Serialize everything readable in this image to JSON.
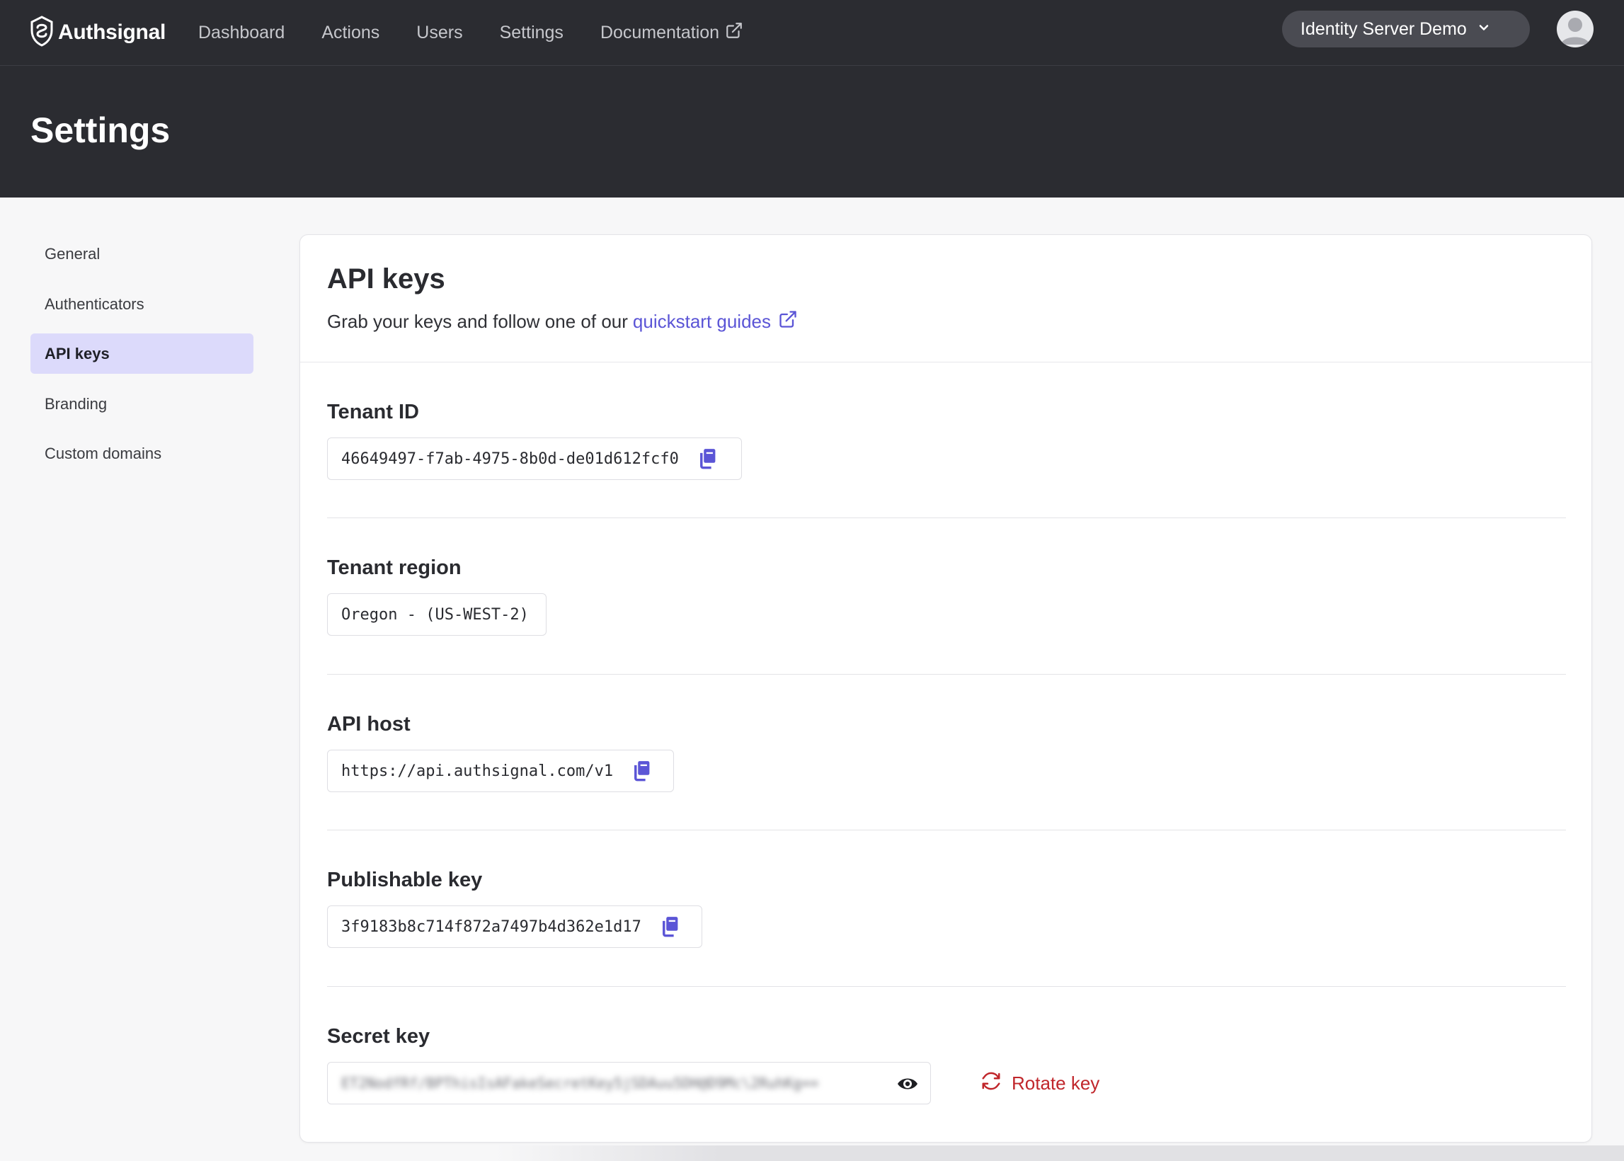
{
  "app": {
    "name": "Authsignal"
  },
  "nav": {
    "items": [
      {
        "label": "Dashboard"
      },
      {
        "label": "Actions"
      },
      {
        "label": "Users"
      },
      {
        "label": "Settings"
      },
      {
        "label": "Documentation"
      }
    ],
    "tenant": "Identity Server Demo"
  },
  "page": {
    "title": "Settings"
  },
  "sidebar": {
    "items": [
      {
        "label": "General"
      },
      {
        "label": "Authenticators"
      },
      {
        "label": "API keys",
        "active": true
      },
      {
        "label": "Branding"
      },
      {
        "label": "Custom domains"
      }
    ]
  },
  "card": {
    "title": "API keys",
    "subtitle": "Grab your keys and follow one of our",
    "link_label": "quickstart guides"
  },
  "fields": {
    "tenant_id": {
      "label": "Tenant ID",
      "value": "46649497-f7ab-4975-8b0d-de01d612fcf0"
    },
    "tenant_region": {
      "label": "Tenant region",
      "value": "Oregon - (US-WEST-2)"
    },
    "api_host": {
      "label": "API host",
      "value": "https://api.authsignal.com/v1"
    },
    "publishable_key": {
      "label": "Publishable key",
      "value": "3f9183b8c714f872a7497b4d362e1d17"
    },
    "secret_key": {
      "label": "Secret key",
      "value": "ET2NodfRf/BPThisIsAFakeSecretKey5jSDAuu5DH@D9Mc\\2RuhKg==",
      "rotate_label": "Rotate key"
    }
  },
  "colors": {
    "accent": "#5b55d6",
    "danger": "#c0262b",
    "header_bg": "#2b2c31",
    "active_item_bg": "#dcdafb"
  },
  "icons": {
    "brand": "authsignal-logo-icon",
    "external": "external-link-icon",
    "chevron": "chevron-down-icon",
    "avatar": "user-avatar-icon",
    "copy": "copy-icon",
    "eye": "eye-icon",
    "rotate": "refresh-icon"
  }
}
